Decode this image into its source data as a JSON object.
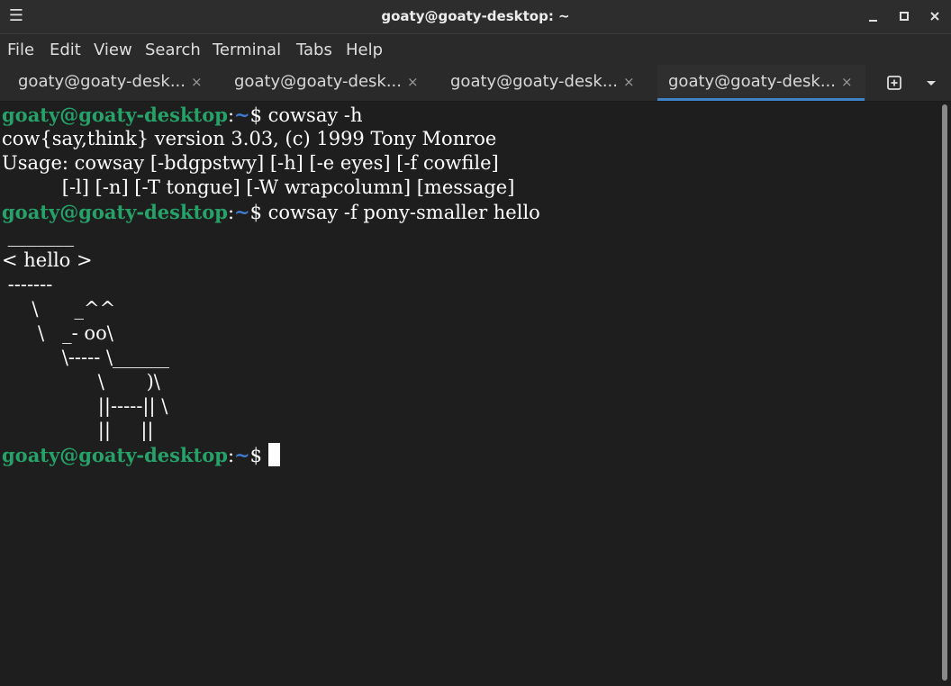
{
  "window": {
    "title": "goaty@goaty-desktop: ~",
    "menu_icon": "hamburger-menu-icon",
    "minimize_label": "–",
    "maximize_label": "▪",
    "close_label": "✕"
  },
  "menubar": {
    "items": [
      "File",
      "Edit",
      "View",
      "Search",
      "Terminal",
      "Tabs",
      "Help"
    ]
  },
  "tabs": [
    {
      "label": "goaty@goaty-desk...",
      "close": "×",
      "active": false
    },
    {
      "label": "goaty@goaty-desk...",
      "close": "×",
      "active": false
    },
    {
      "label": "goaty@goaty-desk...",
      "close": "×",
      "active": false
    },
    {
      "label": "goaty@goaty-desk...",
      "close": "×",
      "active": true
    }
  ],
  "tabbar": {
    "new_tab_icon": "new-tab-icon",
    "tab_menu_icon": "chevron-down-icon",
    "tab_menu_label": "▼"
  },
  "terminal": {
    "prompt_user": "goaty@goaty-desktop",
    "prompt_colon": ":",
    "prompt_path": "~",
    "prompt_symbol": "$ ",
    "command_1": "cowsay -h",
    "output_1": "cow{say,think} version 3.03, (c) 1999 Tony Monroe",
    "output_2": "Usage: cowsay [-bdgpstwy] [-h] [-e eyes] [-f cowfile]",
    "output_3": "          [-l] [-n] [-T tongue] [-W wrapcolumn] [message]",
    "command_2": "cowsay -f pony-smaller hello",
    "art": [
      " _______",
      "< hello >",
      " -------",
      "     \\      _^^",
      "      \\   _- oo\\",
      "          \\----- \\______",
      "                \\       )\\",
      "                ||-----|| \\",
      "                ||     ||"
    ]
  },
  "colors": {
    "prompt_user": "#26a269",
    "prompt_path": "#3f7bd1",
    "active_tab_underline": "#3f82c6",
    "background": "#1e1e1e"
  }
}
